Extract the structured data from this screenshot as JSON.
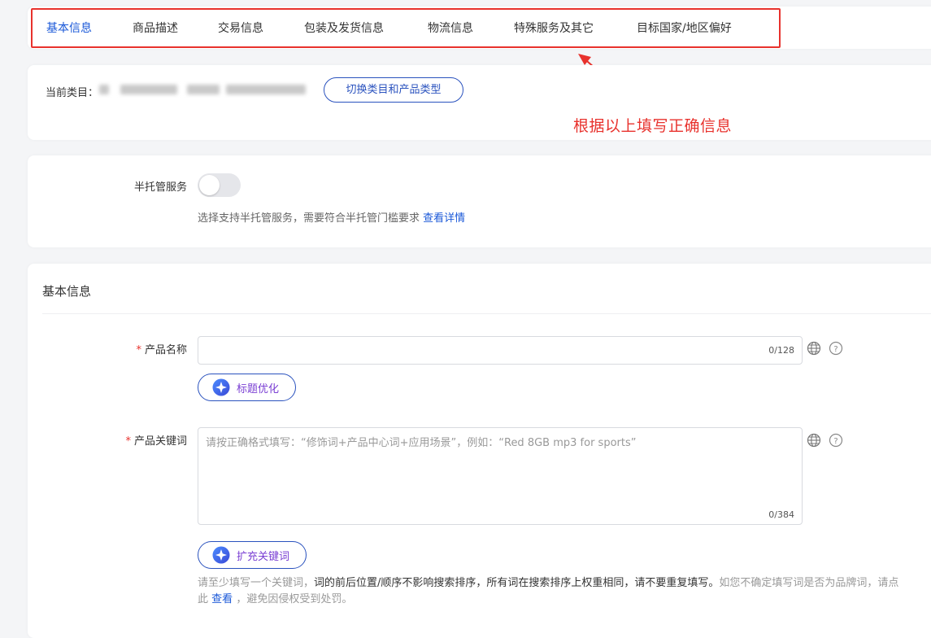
{
  "tabs": [
    {
      "label": "基本信息",
      "active": true
    },
    {
      "label": "商品描述"
    },
    {
      "label": "交易信息"
    },
    {
      "label": "包装及发货信息"
    },
    {
      "label": "物流信息"
    },
    {
      "label": "特殊服务及其它"
    },
    {
      "label": "目标国家/地区偏好"
    }
  ],
  "annotation": {
    "text": "根据以上填写正确信息",
    "color": "#e8322d"
  },
  "category": {
    "label": "当前类目：",
    "switch_button": "切换类目和产品类型"
  },
  "semi_managed": {
    "label": "半托管服务",
    "toggle_on": false,
    "help_text": "选择支持半托管服务，需要符合半托管门槛要求",
    "help_link": "查看详情"
  },
  "basic_info": {
    "title": "基本信息",
    "product_name": {
      "label": "产品名称",
      "value": "",
      "counter": "0/128",
      "ai_button": "标题优化"
    },
    "keywords": {
      "label": "产品关键词",
      "placeholder": "请按正确格式填写：“修饰词+产品中心词+应用场景”，例如：“Red 8GB mp3 for sports”",
      "counter": "0/384",
      "ai_button": "扩充关键词",
      "tip_prefix": "请至少填写一个关键词，",
      "tip_bold": "词的前后位置/顺序不影响搜索排序，所有词在搜索排序上权重相同，请不要重复填写。",
      "tip_suffix": "如您不确定填写词是否为品牌词，请点此",
      "tip_link": "查看",
      "tip_end": "，避免因侵权受到处罚。"
    }
  },
  "colors": {
    "accent": "#1a58d8",
    "annotation": "#e8322d",
    "ai_text": "#7a3fd3"
  }
}
